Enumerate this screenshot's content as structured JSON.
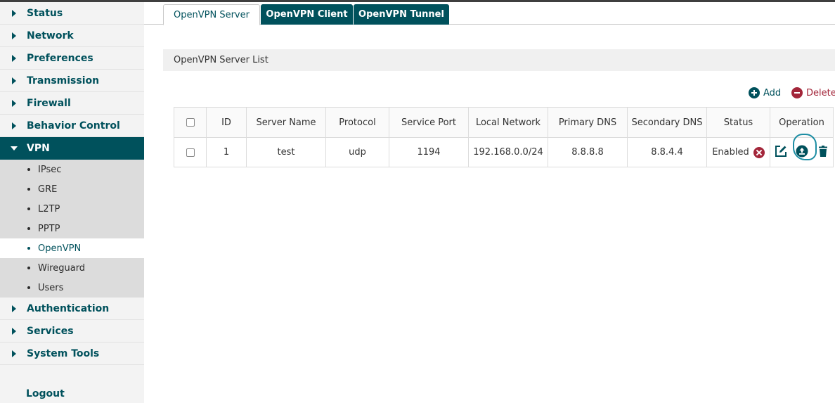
{
  "sidebar": {
    "items": [
      {
        "label": "Status"
      },
      {
        "label": "Network"
      },
      {
        "label": "Preferences"
      },
      {
        "label": "Transmission"
      },
      {
        "label": "Firewall"
      },
      {
        "label": "Behavior Control"
      },
      {
        "label": "VPN",
        "expanded": true
      }
    ],
    "vpn_sub": [
      "IPsec",
      "GRE",
      "L2TP",
      "PPTP",
      "OpenVPN",
      "Wireguard",
      "Users"
    ],
    "vpn_sub_selected": "OpenVPN",
    "items_after": [
      {
        "label": "Authentication"
      },
      {
        "label": "Services"
      },
      {
        "label": "System Tools"
      }
    ],
    "logout": "Logout"
  },
  "tabs": [
    {
      "label": "OpenVPN Server",
      "active": true
    },
    {
      "label": "OpenVPN Client",
      "active": false
    },
    {
      "label": "OpenVPN Tunnel",
      "active": false
    }
  ],
  "section_title": "OpenVPN Server List",
  "actions": {
    "add": "Add",
    "delete": "Delete"
  },
  "table": {
    "headers": [
      "ID",
      "Server Name",
      "Protocol",
      "Service Port",
      "Local Network",
      "Primary DNS",
      "Secondary DNS",
      "Status",
      "Operation"
    ],
    "rows": [
      {
        "id": "1",
        "server_name": "test",
        "protocol": "udp",
        "service_port": "1194",
        "local_network": "192.168.0.0/24",
        "primary_dns": "8.8.8.8",
        "secondary_dns": "8.8.4.4",
        "status": "Enabled"
      }
    ]
  },
  "icons": {
    "edit": "edit-icon",
    "export": "export-icon",
    "delete": "trash-icon",
    "status_disable": "close-circle-icon",
    "add": "plus-circle-icon",
    "delete_action": "minus-circle-icon"
  },
  "colors": {
    "brand": "#00515c",
    "danger": "#a3263a",
    "highlight": "#1c8da3"
  }
}
